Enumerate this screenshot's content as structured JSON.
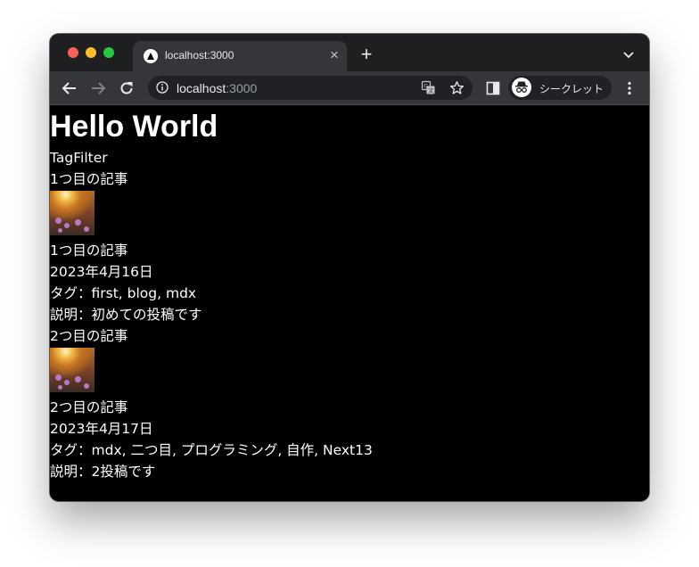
{
  "browser": {
    "tab_title": "localhost:3000",
    "url_host": "localhost",
    "url_port": ":3000",
    "incognito_label": "シークレット",
    "tab_close_glyph": "×",
    "new_tab_glyph": "+"
  },
  "page": {
    "heading": "Hello World",
    "tag_filter": "TagFilter",
    "posts": [
      {
        "link_title": "1つ目の記事",
        "title": "1つ目の記事",
        "date": "2023年4月16日",
        "tags": "タグ：first, blog, mdx",
        "description": "説明：初めての投稿です"
      },
      {
        "link_title": "2つ目の記事",
        "title": "2つ目の記事",
        "date": "2023年4月17日",
        "tags": "タグ：mdx, 二つ目, プログラミング, 自作, Next13",
        "description": "説明：2投稿です"
      }
    ]
  },
  "colors": {
    "page_background": "#000000",
    "text": "#ffffff",
    "titlebar": "#1e1f21",
    "toolbar": "#35363a",
    "omnibox": "#202124"
  }
}
